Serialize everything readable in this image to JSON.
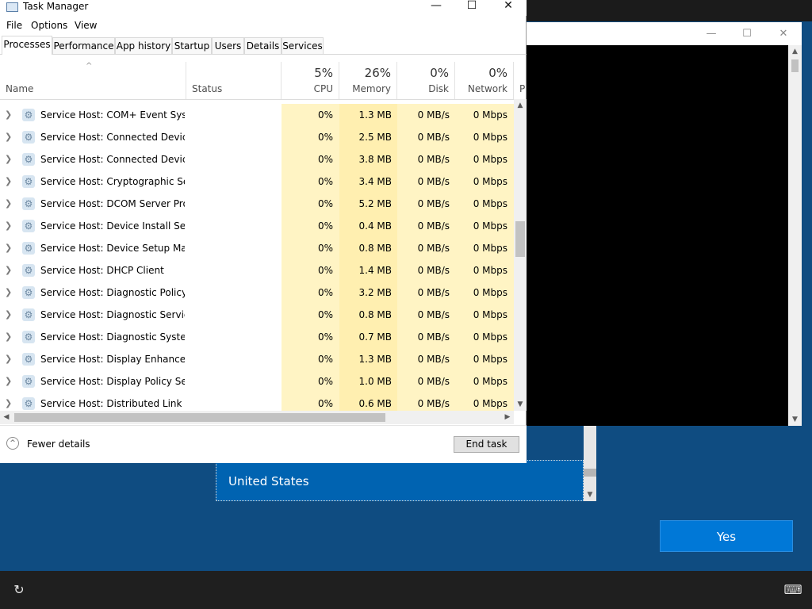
{
  "task_manager": {
    "title": "Task Manager",
    "menu": [
      "File",
      "Options",
      "View"
    ],
    "tabs": [
      "Processes",
      "Performance",
      "App history",
      "Startup",
      "Users",
      "Details",
      "Services"
    ],
    "columns": {
      "name": "Name",
      "status": "Status",
      "cpu": {
        "percent": "5%",
        "label": "CPU"
      },
      "memory": {
        "percent": "26%",
        "label": "Memory"
      },
      "disk": {
        "percent": "0%",
        "label": "Disk"
      },
      "network": {
        "percent": "0%",
        "label": "Network"
      },
      "power_cut": "P"
    },
    "rows": [
      {
        "name": "Service Host: COM+ Event Syste...",
        "cpu": "0%",
        "memory": "1.3 MB",
        "disk": "0 MB/s",
        "network": "0 Mbps"
      },
      {
        "name": "Service Host: Connected Device...",
        "cpu": "0%",
        "memory": "2.5 MB",
        "disk": "0 MB/s",
        "network": "0 Mbps"
      },
      {
        "name": "Service Host: Connected Device...",
        "cpu": "0%",
        "memory": "3.8 MB",
        "disk": "0 MB/s",
        "network": "0 Mbps"
      },
      {
        "name": "Service Host: Cryptographic Ser...",
        "cpu": "0%",
        "memory": "3.4 MB",
        "disk": "0 MB/s",
        "network": "0 Mbps"
      },
      {
        "name": "Service Host: DCOM Server Proc...",
        "cpu": "0%",
        "memory": "5.2 MB",
        "disk": "0 MB/s",
        "network": "0 Mbps"
      },
      {
        "name": "Service Host: Device Install Servi...",
        "cpu": "0%",
        "memory": "0.4 MB",
        "disk": "0 MB/s",
        "network": "0 Mbps"
      },
      {
        "name": "Service Host: Device Setup Man...",
        "cpu": "0%",
        "memory": "0.8 MB",
        "disk": "0 MB/s",
        "network": "0 Mbps"
      },
      {
        "name": "Service Host: DHCP Client",
        "cpu": "0%",
        "memory": "1.4 MB",
        "disk": "0 MB/s",
        "network": "0 Mbps"
      },
      {
        "name": "Service Host: Diagnostic Policy ...",
        "cpu": "0%",
        "memory": "3.2 MB",
        "disk": "0 MB/s",
        "network": "0 Mbps"
      },
      {
        "name": "Service Host: Diagnostic Service...",
        "cpu": "0%",
        "memory": "0.8 MB",
        "disk": "0 MB/s",
        "network": "0 Mbps"
      },
      {
        "name": "Service Host: Diagnostic System...",
        "cpu": "0%",
        "memory": "0.7 MB",
        "disk": "0 MB/s",
        "network": "0 Mbps"
      },
      {
        "name": "Service Host: Display Enhancem...",
        "cpu": "0%",
        "memory": "1.3 MB",
        "disk": "0 MB/s",
        "network": "0 Mbps"
      },
      {
        "name": "Service Host: Display Policy Serv...",
        "cpu": "0%",
        "memory": "1.0 MB",
        "disk": "0 MB/s",
        "network": "0 Mbps"
      },
      {
        "name": "Service Host: Distributed Link Tr...",
        "cpu": "0%",
        "memory": "0.6 MB",
        "disk": "0 MB/s",
        "network": "0 Mbps"
      }
    ],
    "footer": {
      "fewer_details": "Fewer details",
      "end_task": "End task"
    }
  },
  "setup": {
    "selected_country": "United States",
    "yes_button": "Yes"
  },
  "colors": {
    "desktop_bg": "#0f4c81",
    "selection_blue": "#0063b1",
    "accent_button": "#0078d7",
    "cpu_heat": "#fff4c4",
    "memory_heat": "#ffefb0"
  }
}
